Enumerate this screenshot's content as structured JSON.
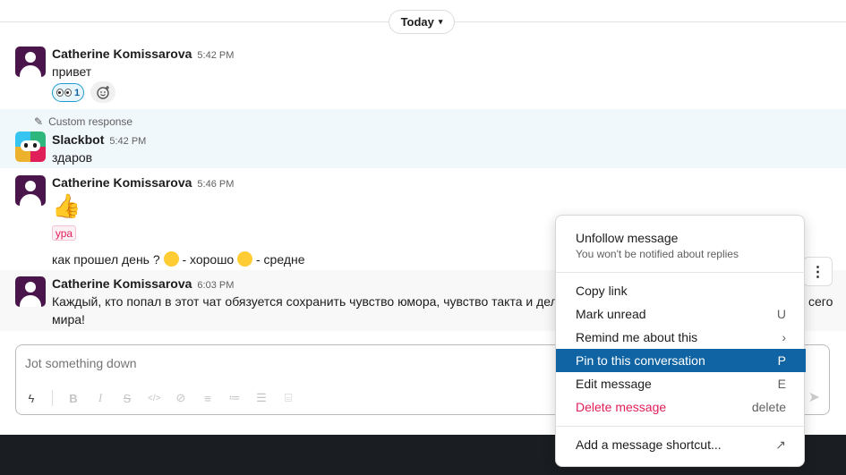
{
  "day_divider": {
    "label": "Today"
  },
  "messages": [
    {
      "author": "Catherine Komissarova",
      "time": "5:42 PM",
      "text": "привет",
      "reaction_count": "1"
    },
    {
      "note": "Custom response",
      "author": "Slackbot",
      "time": "5:42 PM",
      "text": "здаров"
    },
    {
      "author": "Catherine Komissarova",
      "time": "5:46 PM",
      "tag": "ура",
      "text_a": "как прошел день ?",
      "text_b": "- хорошо",
      "text_c": "- средне"
    },
    {
      "author": "Catherine Komissarova",
      "time": "6:03 PM",
      "text_line1": "Каждый, кто попал в этот чат обязуется сохранить чувство юмора, чувство такта и дел",
      "text_tail": "сего",
      "text_line2": "мира!"
    }
  ],
  "composer": {
    "placeholder": "Jot something down"
  },
  "context_menu": {
    "header_title": "Unfollow message",
    "header_subtitle": "You won't be notified about replies",
    "items": [
      {
        "label": "Copy link",
        "key": ""
      },
      {
        "label": "Mark unread",
        "key": "U"
      },
      {
        "label": "Remind me about this",
        "key": "›"
      },
      {
        "label": "Pin to this conversation",
        "key": "P"
      },
      {
        "label": "Edit message",
        "key": "E"
      },
      {
        "label": "Delete message",
        "key": "delete"
      }
    ],
    "shortcut_label": "Add a message shortcut..."
  },
  "colors": {
    "aubergine": "#4a154b",
    "highlight": "#1164a3",
    "danger": "#e01e5a",
    "link_blue": "#1d9bd1"
  }
}
